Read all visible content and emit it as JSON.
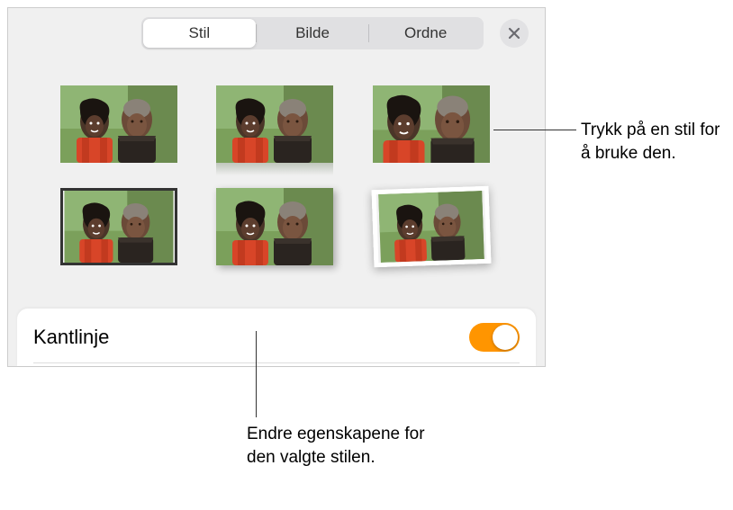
{
  "tabs": {
    "style": "Stil",
    "image": "Bilde",
    "arrange": "Ordne"
  },
  "border_section": {
    "label": "Kantlinje"
  },
  "callouts": {
    "right": "Trykk på en stil for å bruke den.",
    "bottom": "Endre egenskapene for den valgte stilen."
  },
  "icons": {
    "close": "close-icon"
  },
  "colors": {
    "accent": "#ff9500"
  }
}
